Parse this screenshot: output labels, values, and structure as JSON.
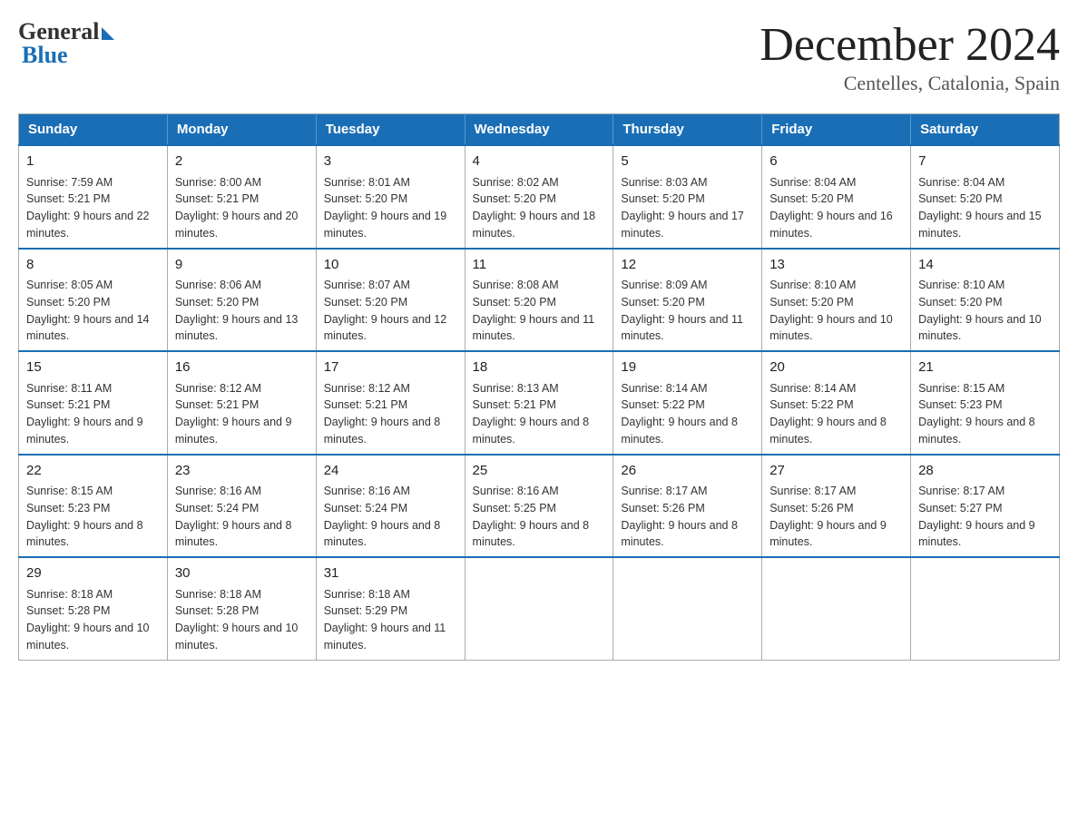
{
  "header": {
    "logo_general": "General",
    "logo_blue": "Blue",
    "month_title": "December 2024",
    "subtitle": "Centelles, Catalonia, Spain"
  },
  "days": [
    "Sunday",
    "Monday",
    "Tuesday",
    "Wednesday",
    "Thursday",
    "Friday",
    "Saturday"
  ],
  "weeks": [
    [
      {
        "day": "1",
        "sunrise": "Sunrise: 7:59 AM",
        "sunset": "Sunset: 5:21 PM",
        "daylight": "Daylight: 9 hours and 22 minutes."
      },
      {
        "day": "2",
        "sunrise": "Sunrise: 8:00 AM",
        "sunset": "Sunset: 5:21 PM",
        "daylight": "Daylight: 9 hours and 20 minutes."
      },
      {
        "day": "3",
        "sunrise": "Sunrise: 8:01 AM",
        "sunset": "Sunset: 5:20 PM",
        "daylight": "Daylight: 9 hours and 19 minutes."
      },
      {
        "day": "4",
        "sunrise": "Sunrise: 8:02 AM",
        "sunset": "Sunset: 5:20 PM",
        "daylight": "Daylight: 9 hours and 18 minutes."
      },
      {
        "day": "5",
        "sunrise": "Sunrise: 8:03 AM",
        "sunset": "Sunset: 5:20 PM",
        "daylight": "Daylight: 9 hours and 17 minutes."
      },
      {
        "day": "6",
        "sunrise": "Sunrise: 8:04 AM",
        "sunset": "Sunset: 5:20 PM",
        "daylight": "Daylight: 9 hours and 16 minutes."
      },
      {
        "day": "7",
        "sunrise": "Sunrise: 8:04 AM",
        "sunset": "Sunset: 5:20 PM",
        "daylight": "Daylight: 9 hours and 15 minutes."
      }
    ],
    [
      {
        "day": "8",
        "sunrise": "Sunrise: 8:05 AM",
        "sunset": "Sunset: 5:20 PM",
        "daylight": "Daylight: 9 hours and 14 minutes."
      },
      {
        "day": "9",
        "sunrise": "Sunrise: 8:06 AM",
        "sunset": "Sunset: 5:20 PM",
        "daylight": "Daylight: 9 hours and 13 minutes."
      },
      {
        "day": "10",
        "sunrise": "Sunrise: 8:07 AM",
        "sunset": "Sunset: 5:20 PM",
        "daylight": "Daylight: 9 hours and 12 minutes."
      },
      {
        "day": "11",
        "sunrise": "Sunrise: 8:08 AM",
        "sunset": "Sunset: 5:20 PM",
        "daylight": "Daylight: 9 hours and 11 minutes."
      },
      {
        "day": "12",
        "sunrise": "Sunrise: 8:09 AM",
        "sunset": "Sunset: 5:20 PM",
        "daylight": "Daylight: 9 hours and 11 minutes."
      },
      {
        "day": "13",
        "sunrise": "Sunrise: 8:10 AM",
        "sunset": "Sunset: 5:20 PM",
        "daylight": "Daylight: 9 hours and 10 minutes."
      },
      {
        "day": "14",
        "sunrise": "Sunrise: 8:10 AM",
        "sunset": "Sunset: 5:20 PM",
        "daylight": "Daylight: 9 hours and 10 minutes."
      }
    ],
    [
      {
        "day": "15",
        "sunrise": "Sunrise: 8:11 AM",
        "sunset": "Sunset: 5:21 PM",
        "daylight": "Daylight: 9 hours and 9 minutes."
      },
      {
        "day": "16",
        "sunrise": "Sunrise: 8:12 AM",
        "sunset": "Sunset: 5:21 PM",
        "daylight": "Daylight: 9 hours and 9 minutes."
      },
      {
        "day": "17",
        "sunrise": "Sunrise: 8:12 AM",
        "sunset": "Sunset: 5:21 PM",
        "daylight": "Daylight: 9 hours and 8 minutes."
      },
      {
        "day": "18",
        "sunrise": "Sunrise: 8:13 AM",
        "sunset": "Sunset: 5:21 PM",
        "daylight": "Daylight: 9 hours and 8 minutes."
      },
      {
        "day": "19",
        "sunrise": "Sunrise: 8:14 AM",
        "sunset": "Sunset: 5:22 PM",
        "daylight": "Daylight: 9 hours and 8 minutes."
      },
      {
        "day": "20",
        "sunrise": "Sunrise: 8:14 AM",
        "sunset": "Sunset: 5:22 PM",
        "daylight": "Daylight: 9 hours and 8 minutes."
      },
      {
        "day": "21",
        "sunrise": "Sunrise: 8:15 AM",
        "sunset": "Sunset: 5:23 PM",
        "daylight": "Daylight: 9 hours and 8 minutes."
      }
    ],
    [
      {
        "day": "22",
        "sunrise": "Sunrise: 8:15 AM",
        "sunset": "Sunset: 5:23 PM",
        "daylight": "Daylight: 9 hours and 8 minutes."
      },
      {
        "day": "23",
        "sunrise": "Sunrise: 8:16 AM",
        "sunset": "Sunset: 5:24 PM",
        "daylight": "Daylight: 9 hours and 8 minutes."
      },
      {
        "day": "24",
        "sunrise": "Sunrise: 8:16 AM",
        "sunset": "Sunset: 5:24 PM",
        "daylight": "Daylight: 9 hours and 8 minutes."
      },
      {
        "day": "25",
        "sunrise": "Sunrise: 8:16 AM",
        "sunset": "Sunset: 5:25 PM",
        "daylight": "Daylight: 9 hours and 8 minutes."
      },
      {
        "day": "26",
        "sunrise": "Sunrise: 8:17 AM",
        "sunset": "Sunset: 5:26 PM",
        "daylight": "Daylight: 9 hours and 8 minutes."
      },
      {
        "day": "27",
        "sunrise": "Sunrise: 8:17 AM",
        "sunset": "Sunset: 5:26 PM",
        "daylight": "Daylight: 9 hours and 9 minutes."
      },
      {
        "day": "28",
        "sunrise": "Sunrise: 8:17 AM",
        "sunset": "Sunset: 5:27 PM",
        "daylight": "Daylight: 9 hours and 9 minutes."
      }
    ],
    [
      {
        "day": "29",
        "sunrise": "Sunrise: 8:18 AM",
        "sunset": "Sunset: 5:28 PM",
        "daylight": "Daylight: 9 hours and 10 minutes."
      },
      {
        "day": "30",
        "sunrise": "Sunrise: 8:18 AM",
        "sunset": "Sunset: 5:28 PM",
        "daylight": "Daylight: 9 hours and 10 minutes."
      },
      {
        "day": "31",
        "sunrise": "Sunrise: 8:18 AM",
        "sunset": "Sunset: 5:29 PM",
        "daylight": "Daylight: 9 hours and 11 minutes."
      },
      null,
      null,
      null,
      null
    ]
  ]
}
